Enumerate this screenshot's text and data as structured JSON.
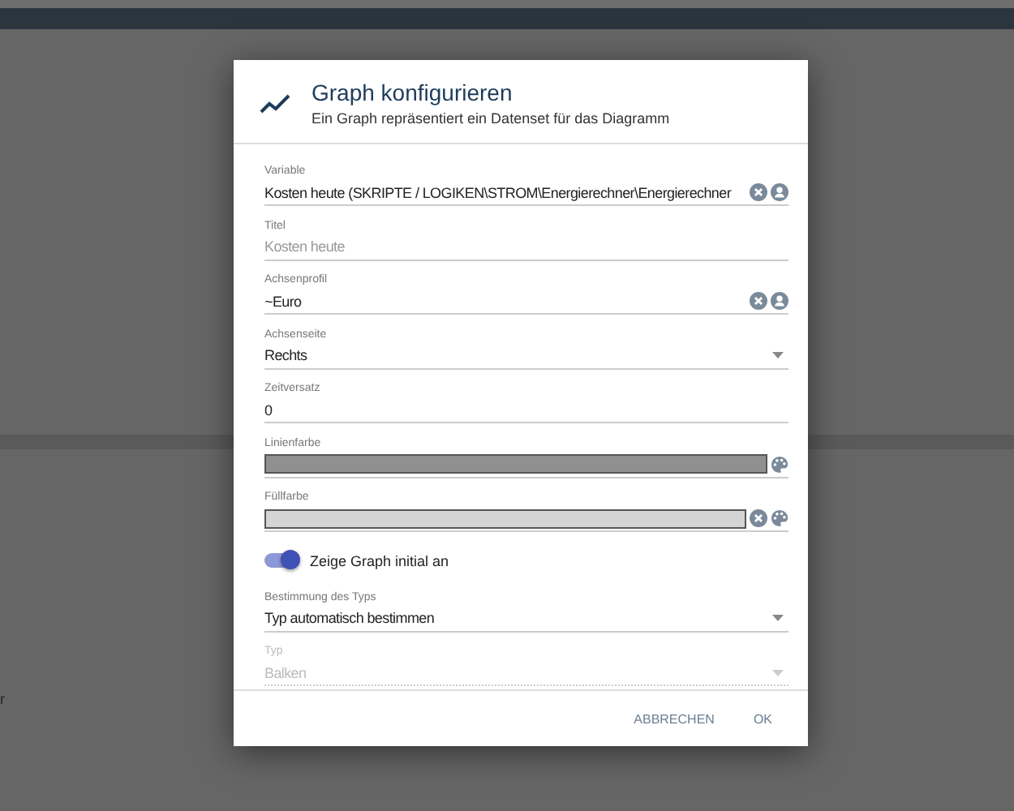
{
  "background_text": "r",
  "dialog": {
    "title": "Graph konfigurieren",
    "subtitle": "Ein Graph repräsentiert ein Datenset für das Diagramm",
    "fields": [
      {
        "kind": "input",
        "label": "Variable",
        "value": "Kosten heute (SKRIPTE / LOGIKEN\\STROM\\Energierechner\\Energierechner",
        "clear": true,
        "pick": true,
        "disabled": false
      },
      {
        "kind": "input",
        "label": "Titel",
        "placeholder": "Kosten heute",
        "clear": false,
        "pick": false,
        "disabled": false
      },
      {
        "kind": "input",
        "label": "Achsenprofil",
        "value": "~Euro",
        "clear": true,
        "pick": true,
        "disabled": false
      },
      {
        "kind": "select",
        "label": "Achsenseite",
        "value": "Rechts",
        "disabled": false
      },
      {
        "kind": "input",
        "label": "Zeitversatz",
        "value": "0",
        "clear": false,
        "pick": false,
        "disabled": false
      },
      {
        "kind": "color",
        "label": "Linienfarbe",
        "color": "#909090",
        "clear": false
      },
      {
        "kind": "color",
        "label": "Füllfarbe",
        "color": "#d4d4d4",
        "clear": true
      },
      {
        "kind": "toggle",
        "label": "Zeige Graph initial an",
        "on": true
      },
      {
        "kind": "select",
        "label": "Bestimmung des Typs",
        "value": "Typ automatisch bestimmen",
        "disabled": false
      },
      {
        "kind": "select",
        "label": "Typ",
        "value": "Balken",
        "disabled": true
      }
    ],
    "buttons": [
      "ABBRECHEN",
      "OK"
    ]
  }
}
